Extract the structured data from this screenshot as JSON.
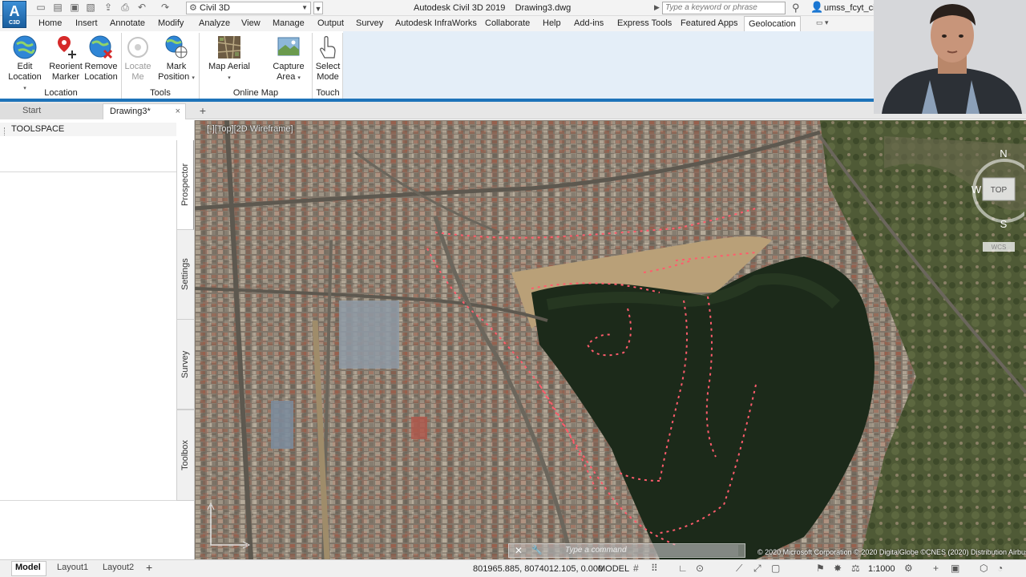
{
  "app": {
    "title": "Autodesk Civil 3D 2019    Drawing3.dwg",
    "logo_letter": "A",
    "logo_sub": "C3D",
    "workspace": "Civil 3D",
    "search_placeholder": "Type a keyword or phrase",
    "user_name": "umss_fcyt_civ"
  },
  "ribbon_tabs": [
    "Home",
    "Insert",
    "Annotate",
    "Modify",
    "Analyze",
    "View",
    "Manage",
    "Output",
    "Survey",
    "Autodesk InfraWorks",
    "Collaborate",
    "Help",
    "Add-ins",
    "Express Tools",
    "Featured Apps",
    "Geolocation"
  ],
  "active_tab": "Geolocation",
  "ribbon": {
    "edit_location": [
      "Edit",
      "Location"
    ],
    "reorient_marker": [
      "Reorient",
      "Marker"
    ],
    "remove_location": [
      "Remove",
      "Location"
    ],
    "locate_me": [
      "Locate",
      "Me"
    ],
    "mark_position": [
      "Mark",
      "Position"
    ],
    "map_aerial": "Map Aerial",
    "capture_area": [
      "Capture",
      "Area"
    ],
    "select_mode": [
      "Select",
      "Mode"
    ],
    "panels": {
      "location": "Location",
      "tools": "Tools",
      "online_map": "Online Map",
      "touch": "Touch"
    }
  },
  "file_tabs": {
    "start": "Start",
    "drawing": "Drawing3*"
  },
  "toolspace": {
    "title": "TOOLSPACE",
    "tabs": [
      "Prospector",
      "Settings",
      "Survey",
      "Toolbox"
    ]
  },
  "viewport": {
    "label": "[-][Top][2D Wireframe]",
    "viewcube": {
      "n": "N",
      "s": "S",
      "w": "W",
      "top": "TOP",
      "wcs": "WCS"
    },
    "command_placeholder": "Type a command",
    "copyright": "© 2020 Microsoft Corporation © 2020 DigitalGlobe ©CNES (2020) Distribution Airbus DS"
  },
  "status_bar": {
    "layout_tabs": [
      "Model",
      "Layout1",
      "Layout2"
    ],
    "coordinates": "801965.885, 8074012.105, 0.000",
    "mode": "MODEL",
    "scale": "1:1000"
  }
}
